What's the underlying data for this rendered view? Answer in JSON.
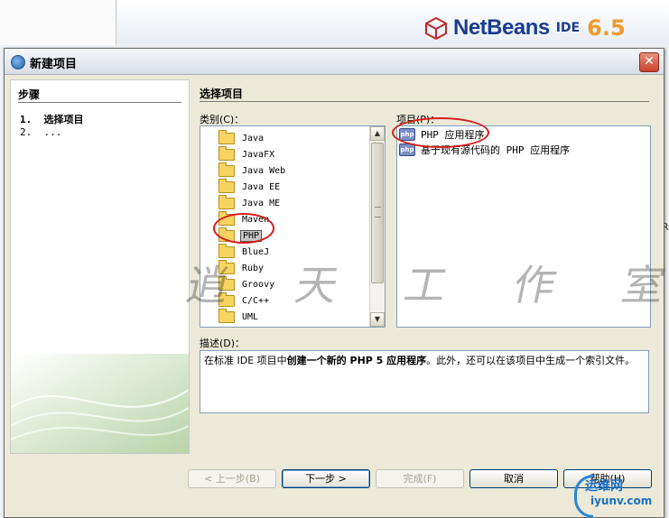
{
  "background": {
    "logo_text": "NetBeans",
    "logo_ide": "IDE",
    "logo_version": "6.5",
    "right_edge_letter": "R"
  },
  "dialog": {
    "title": "新建项目",
    "close_glyph": "✕"
  },
  "steps_panel": {
    "heading": "步骤",
    "items": [
      {
        "text": "1.  选择项目",
        "current": true
      },
      {
        "text": "2.  ...",
        "current": false
      }
    ]
  },
  "main": {
    "heading": "选择项目",
    "categories_label": "类别(C)：",
    "projects_label": "项目(P)：",
    "categories": [
      {
        "label": "Java",
        "selected": false
      },
      {
        "label": "JavaFX",
        "selected": false
      },
      {
        "label": "Java Web",
        "selected": false
      },
      {
        "label": "Java EE",
        "selected": false
      },
      {
        "label": "Java ME",
        "selected": false
      },
      {
        "label": "Maven",
        "selected": false
      },
      {
        "label": "PHP",
        "selected": true
      },
      {
        "label": "BlueJ",
        "selected": false
      },
      {
        "label": "Ruby",
        "selected": false
      },
      {
        "label": "Groovy",
        "selected": false
      },
      {
        "label": "C/C++",
        "selected": false
      },
      {
        "label": "UML",
        "selected": false
      }
    ],
    "projects": [
      {
        "label": "PHP 应用程序",
        "icon": "php-icon"
      },
      {
        "label": "基于现有源代码的 PHP 应用程序",
        "icon": "php-icon"
      }
    ],
    "description_label": "描述(D)：",
    "description_part1": "在标准 IDE 项目中",
    "description_bold": "创建一个新的 PHP 5 应用程序",
    "description_part2": "。此外，还可以在该项目中生成一个索引文件。"
  },
  "buttons": {
    "back": "< 上一步(B)",
    "next": "下一步 >",
    "finish": "完成(F)",
    "cancel": "取消",
    "help": "帮助(H)"
  },
  "watermark": {
    "text": "逍 天 工 作 室",
    "corner_line1": "运维网",
    "corner_line2": "iyunv.com"
  },
  "colors": {
    "accent_blue": "#1a3d8f",
    "logo_orange": "#f29a2e",
    "annotation_red": "#d81a1a"
  }
}
